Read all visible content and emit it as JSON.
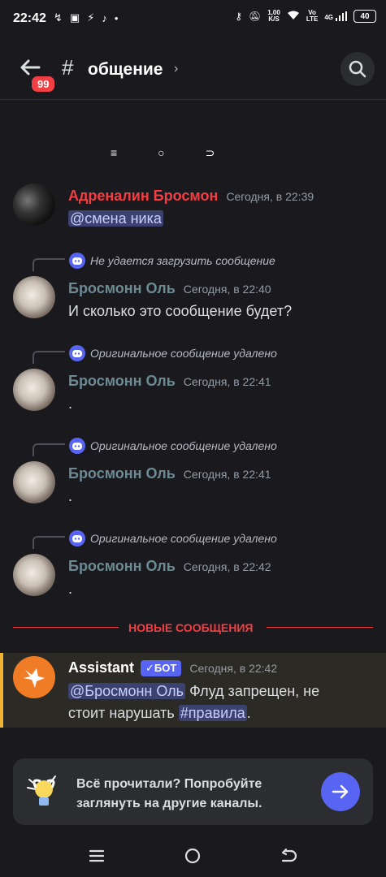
{
  "status_bar": {
    "time": "22:42",
    "speed_value": "1,00",
    "speed_unit": "K/S",
    "network_top": "Vo",
    "network_bottom": "LTE",
    "signal_label": "4G",
    "battery": "40"
  },
  "header": {
    "unread_badge": "99",
    "hash": "#",
    "channel_name": "общение",
    "chevron": "›"
  },
  "mini_nav": {
    "menu": "≡",
    "home": "○",
    "back": "⊃"
  },
  "messages": [
    {
      "username": "Адреналин Бросмон",
      "name_color": "#f23f43",
      "timestamp": "Сегодня, в 22:39",
      "mention": "@смена ника"
    },
    {
      "reply": "Не удается загрузить сообщение",
      "username": "Бросмонн Оль",
      "name_color": "#6d8a93",
      "timestamp": "Сегодня, в 22:40",
      "text": "И сколько это сообщение будет?"
    },
    {
      "reply": "Оригинальное сообщение удалено",
      "username": "Бросмонн Оль",
      "timestamp": "Сегодня, в 22:41",
      "text": "."
    },
    {
      "reply": "Оригинальное сообщение удалено",
      "username": "Бросмонн Оль",
      "timestamp": "Сегодня, в 22:41",
      "text": "."
    },
    {
      "reply": "Оригинальное сообщение удалено",
      "username": "Бросмонн Оль",
      "timestamp": "Сегодня, в 22:42",
      "text": "."
    }
  ],
  "divider": {
    "label": "НОВЫЕ СООБЩЕНИЯ"
  },
  "bot_message": {
    "username": "Assistant",
    "badge": "✓БОТ",
    "timestamp": "Сегодня, в 22:42",
    "mention": "@Бросмонн Оль",
    "text_part1": " Флуд запрещен, не",
    "text_part2": "стоит нарушать ",
    "channel_link": "#правила",
    "text_end": "."
  },
  "bottom_card": {
    "line1": "Всё прочитали? Попробуйте",
    "line2": "заглянуть на другие каналы."
  },
  "colors": {
    "background": "#1a1a1e",
    "accent": "#5865f2",
    "danger": "#f23f43",
    "highlight": "#f0b232"
  }
}
